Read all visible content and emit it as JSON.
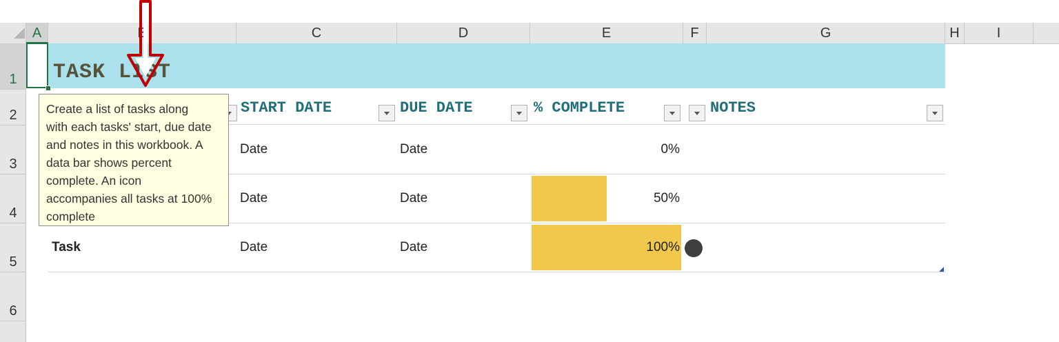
{
  "columns": [
    "A",
    "B",
    "C",
    "D",
    "E",
    "F",
    "G",
    "H",
    "I"
  ],
  "rows": [
    "1",
    "2",
    "3",
    "4",
    "5",
    "6"
  ],
  "title": "TASK LIST",
  "table": {
    "headers": {
      "start_date": "START DATE",
      "due_date": "DUE DATE",
      "complete": "% COMPLETE",
      "notes": "NOTES"
    },
    "rows": [
      {
        "task": "",
        "start": "Date",
        "due": "Date",
        "pct": "0%",
        "pct_value": 0
      },
      {
        "task": "",
        "start": "Date",
        "due": "Date",
        "pct": "50%",
        "pct_value": 50
      },
      {
        "task": "Task",
        "start": "Date",
        "due": "Date",
        "pct": "100%",
        "pct_value": 100,
        "icon": "filled-circle-icon"
      }
    ]
  },
  "tooltip": {
    "lines": [
      "Create a list of tasks along",
      "with each tasks' start, due date",
      "and notes in this workbook. A",
      "data bar shows percent",
      "complete.  An icon",
      "accompanies all tasks at 100%",
      "complete"
    ]
  },
  "colors": {
    "title_band": "#abe1ec",
    "data_bar": "#f0c84b",
    "header_text": "#1f6e7a",
    "arrow": "#c00000",
    "selection": "#217346"
  }
}
